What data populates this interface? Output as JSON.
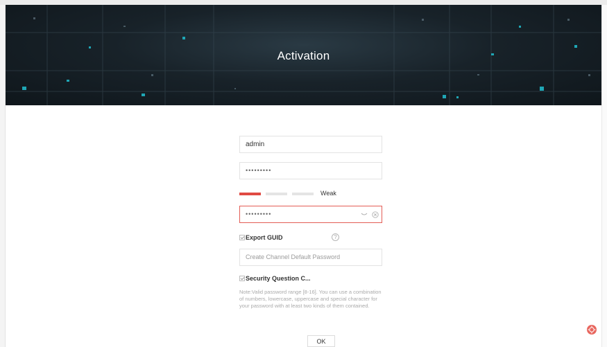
{
  "dialog": {
    "title": "Activation"
  },
  "form": {
    "username": {
      "value": "admin"
    },
    "password": {
      "value": "•••••••••"
    },
    "password_strength": {
      "label": "Weak",
      "level": 1,
      "levels_total": 3
    },
    "confirm_password": {
      "value": "•••••••••"
    },
    "export_guid": {
      "label": "Export GUID",
      "checked": true
    },
    "channel_password": {
      "placeholder": "Create Channel Default Password"
    },
    "security_question": {
      "label": "Security Question C...",
      "checked": true
    },
    "note": "Note:Valid password range [8-16]. You can use a combination of numbers, lowercase, uppercase and special character for your password with at least two kinds of them contained."
  },
  "actions": {
    "ok_label": "OK"
  },
  "icons": {
    "eye": "eye-closed-icon",
    "clear": "clear-circle-icon",
    "help": "question-circle-icon",
    "floating": "assistant-badge-icon"
  },
  "colors": {
    "accent_red": "#e04a43",
    "focus_border": "#e35c55",
    "banner_dark": "#182229"
  }
}
